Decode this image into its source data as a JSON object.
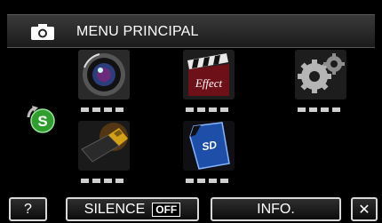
{
  "header": {
    "title": "MENU PRINCIPAL",
    "icon": "camera-icon"
  },
  "mode_icon": "switch-mode-s-icon",
  "tiles": [
    {
      "icon": "lens-icon",
      "page_dots": 4
    },
    {
      "icon": "effect-clapper-icon",
      "label": "Effect",
      "page_dots": 4
    },
    {
      "icon": "gear-settings-icon",
      "page_dots": 4
    },
    {
      "icon": "usb-connector-icon",
      "page_dots": 4
    },
    {
      "icon": "sd-card-icon",
      "label": "SD",
      "page_dots": 4
    }
  ],
  "buttons": {
    "help": "?",
    "silence": "SILENCE",
    "silence_state": "OFF",
    "info": "INFO.",
    "close": "✕"
  },
  "colors": {
    "mode_green": "#2f9e2f",
    "button_border": "#d8d8d8"
  }
}
